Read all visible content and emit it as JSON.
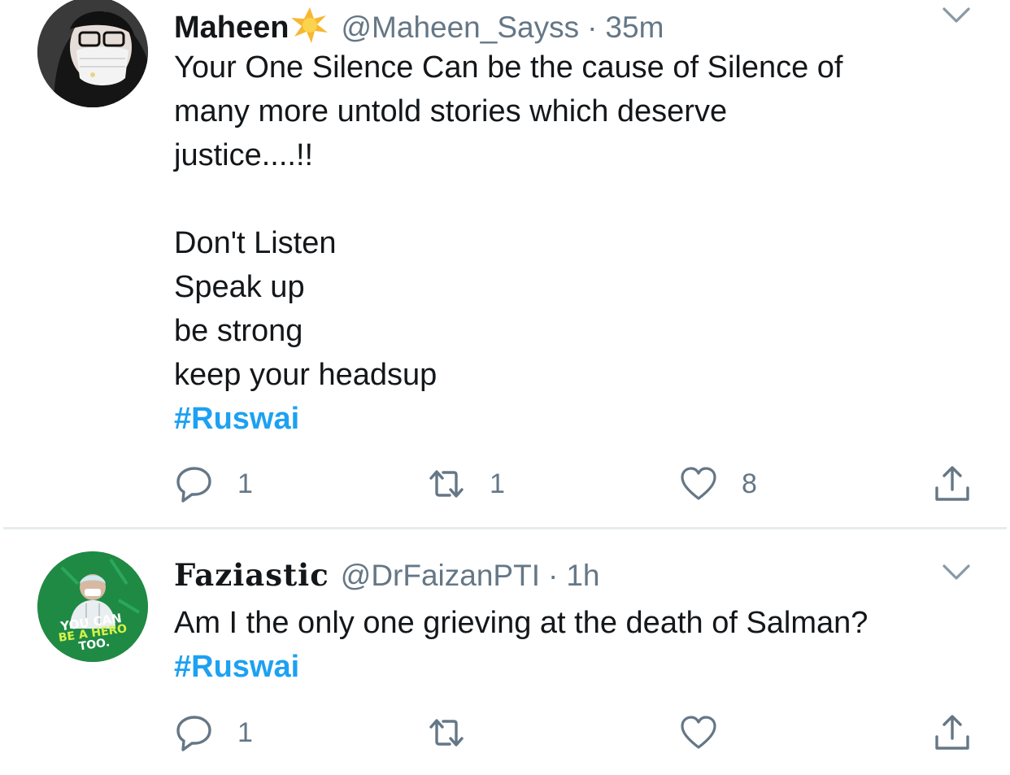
{
  "tweets": [
    {
      "name": "Maheen",
      "handle": "@Maheen_Sayss",
      "separator": "·",
      "time": "35m",
      "name_emoji_icon": "sun-star-emoji-icon",
      "text_lines": [
        "Your One Silence Can be the cause of Silence of",
        "many more untold stories which deserve",
        "justice....!!"
      ],
      "text_lines_2": [
        "Don't Listen",
        "Speak up",
        "be strong",
        "keep your headsup"
      ],
      "hashtag": "#Ruswai",
      "replies": "1",
      "retweets": "1",
      "likes": "8"
    },
    {
      "name": "Faziastic",
      "handle": "@DrFaizanPTI",
      "separator": "·",
      "time": "1h",
      "avatar_text": [
        "YOU CAN",
        "BE A HERO",
        "TOO."
      ],
      "text_lines": [
        "Am I the only one grieving at the death of Salman?"
      ],
      "hashtag": "#Ruswai",
      "replies": "1",
      "retweets": "",
      "likes": ""
    }
  ],
  "colors": {
    "text": "#14171a",
    "secondary": "#657786",
    "link": "#1da1f2",
    "divider": "#e6ecf0",
    "star": "#f7b731"
  }
}
